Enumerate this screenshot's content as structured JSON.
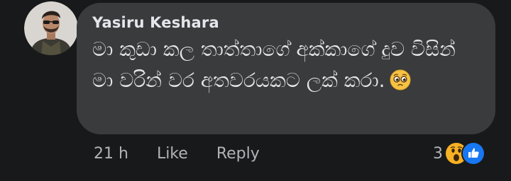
{
  "comment": {
    "author": "Yasiru Keshara",
    "text": "මා කුඩා කල තාත්තාගේ අක්කාගේ දුව විසින් මා වරින් වර අතවරයකට ලක් කරා.",
    "emoji": "pleading-face-emoji"
  },
  "footer": {
    "time": "21 h",
    "like": "Like",
    "reply": "Reply"
  },
  "reactions": {
    "count": "3",
    "types": [
      "wow-reaction-icon",
      "like-reaction-icon"
    ]
  },
  "colors": {
    "background": "#18191a",
    "bubble": "#3a3b3c",
    "text": "#e4e6eb",
    "secondary": "#b0b3b8",
    "like_blue": "#1877f2",
    "wow_yellow": "#f7b125"
  }
}
